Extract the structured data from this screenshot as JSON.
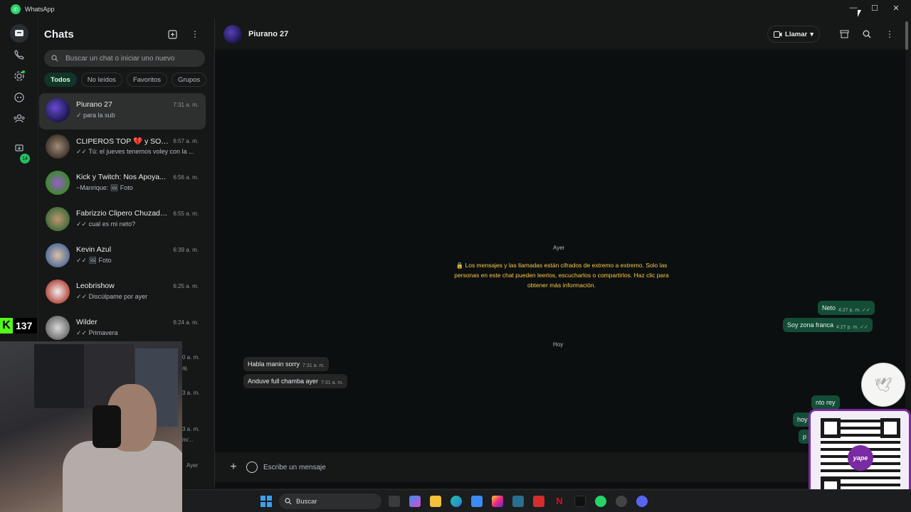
{
  "app": {
    "title": "WhatsApp"
  },
  "sidebar": {
    "updates_badge": "14",
    "kick_count": "137"
  },
  "chatlist": {
    "title": "Chats",
    "search_placeholder": "Buscar un chat o iniciar uno nuevo",
    "filters": [
      "Todos",
      "No leídos",
      "Favoritos",
      "Grupos"
    ],
    "rows": [
      {
        "name": "Piurano 27",
        "time": "7:31 a. m.",
        "preview": "✓ para la sub",
        "avatar": "#3b2fa0"
      },
      {
        "name": "CLIPEROS TOP 💔 y SON ...",
        "time": "6:57 a. m.",
        "preview": "✓✓ Tú: el jueves tenemos voley con la ...",
        "avatar": "#7a6a5a"
      },
      {
        "name": "Kick y Twitch: Nos Apoya...",
        "time": "6:56 a. m.",
        "preview": "~Manrique: 🖼 Foto",
        "avatar": "#4aa83a"
      },
      {
        "name": "Fabrizzio Clipero Chuzado...",
        "time": "6:55 a. m.",
        "preview": "✓✓ cual es mi neto?",
        "avatar": "#8a5b3c"
      },
      {
        "name": "Kevin Azul",
        "time": "6:39 a. m.",
        "preview": "✓✓ 🖼 Foto",
        "avatar": "#5f6f8c"
      },
      {
        "name": "Leobrishow",
        "time": "6:25 a. m.",
        "preview": "✓✓ Discúlpame  por ayer",
        "avatar": "#b5453a"
      },
      {
        "name": "Wilder",
        "time": "6:24 a. m.",
        "preview": "✓✓ Primavera",
        "avatar": "#6b6b6b"
      }
    ],
    "tail_times": [
      "0 a. m.",
      "3 a. m.",
      "3 a. m.",
      "Ayer"
    ],
    "tail_previews": [
      "aj.",
      "m/..."
    ]
  },
  "chat": {
    "contact": "Piurano 27",
    "call_label": "Llamar",
    "day_ayer": "Ayer",
    "day_hoy": "Hoy",
    "encryption_notice": "🔒 Los mensajes y las llamadas están cifrados de extremo a extremo. Solo las personas en este chat pueden leerlos, escucharlos o compartirlos. Haz clic para obtener más información.",
    "messages": [
      {
        "dir": "out",
        "text": "Neto",
        "time": "4:27 p. m. ✓✓"
      },
      {
        "dir": "out",
        "text": "Soy zona franca",
        "time": "4:27 p. m. ✓✓"
      },
      {
        "dir": "in",
        "text": "Habla manin sorry",
        "time": "7:31 a. m."
      },
      {
        "dir": "in",
        "text": "Anduve full chamba ayer",
        "time": "7:31 a. m."
      },
      {
        "dir": "out",
        "text": "nto rey",
        "time": ""
      },
      {
        "dir": "out",
        "text": "hoy",
        "time": ""
      },
      {
        "dir": "out",
        "text": "p",
        "time": ""
      }
    ],
    "composer_placeholder": "Escribe un mensaje"
  },
  "overlay": {
    "qr_brand": "yape"
  },
  "taskbar": {
    "search_label": "Buscar"
  },
  "colors": {
    "accent": "#25d366",
    "outgoing": "#144d37",
    "incoming": "#242626",
    "notice": "#f7c84a"
  }
}
